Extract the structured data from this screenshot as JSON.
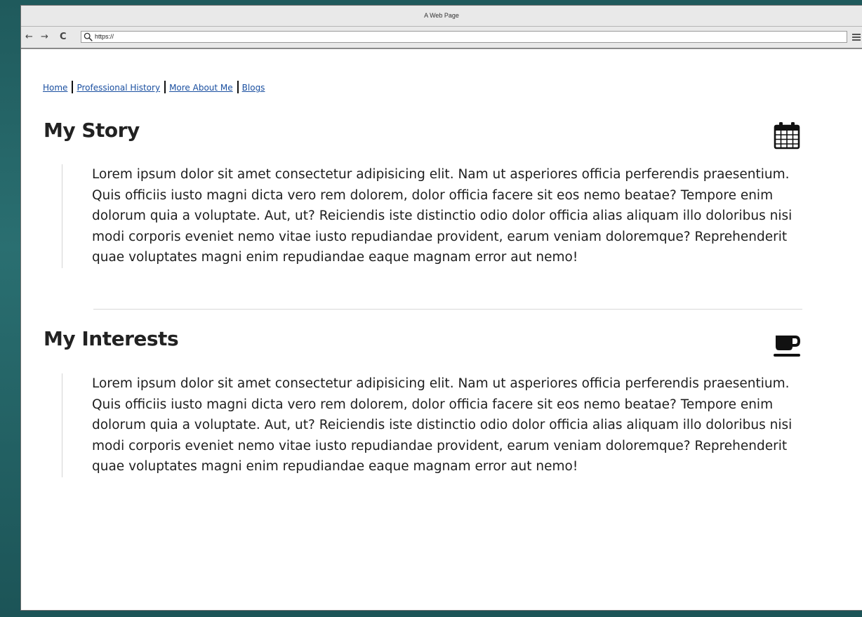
{
  "browser": {
    "title": "A Web Page",
    "url": "https://",
    "nav": {
      "back_glyph": "←",
      "forward_glyph": "→",
      "reload_glyph": "C"
    }
  },
  "topnav": {
    "links": [
      "Home",
      "Professional History",
      "More About Me",
      "Blogs"
    ]
  },
  "sections": [
    {
      "title": "My Story",
      "icon": "calendar-icon",
      "body": "Lorem ipsum dolor sit amet consectetur adipisicing elit. Nam ut asperiores officia perferendis praesentium. Quis officiis iusto magni dicta vero rem dolorem, dolor officia facere sit eos nemo beatae? Tempore enim dolorum quia a voluptate. Aut, ut? Reiciendis iste distinctio odio dolor officia alias aliquam illo doloribus nisi modi corporis eveniet nemo vitae iusto repudiandae provident, earum veniam doloremque? Reprehenderit quae voluptates magni enim repudiandae eaque magnam error aut nemo!"
    },
    {
      "title": "My Interests",
      "icon": "coffee-cup-icon",
      "body": "Lorem ipsum dolor sit amet consectetur adipisicing elit. Nam ut asperiores officia perferendis praesentium. Quis officiis iusto magni dicta vero rem dolorem, dolor officia facere sit eos nemo beatae? Tempore enim dolorum quia a voluptate. Aut, ut? Reiciendis iste distinctio odio dolor officia alias aliquam illo doloribus nisi modi corporis eveniet nemo vitae iusto repudiandae provident, earum veniam doloremque? Reprehenderit quae voluptates magni enim repudiandae eaque magnam error aut nemo!"
    }
  ]
}
